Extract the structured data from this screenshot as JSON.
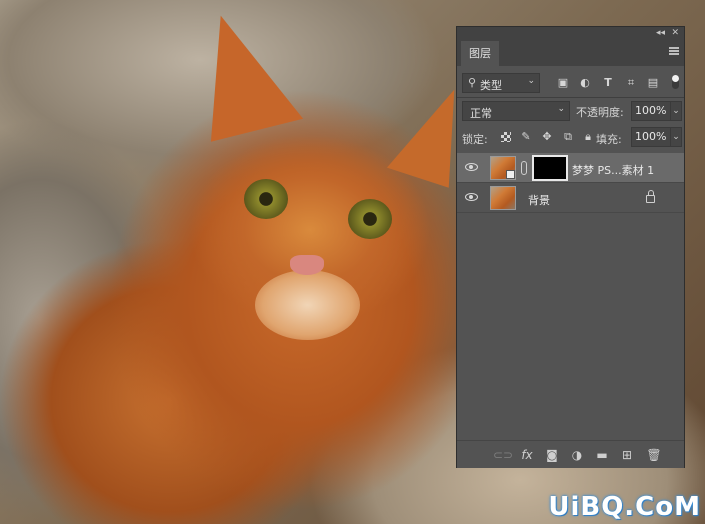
{
  "panel": {
    "tab_label": "图层",
    "collapse_glyph": "◂◂",
    "close_glyph": "✕",
    "filter": {
      "label": "类型",
      "icons": [
        "image-filter-icon",
        "adjustment-filter-icon",
        "type-filter-icon",
        "shape-filter-icon",
        "smart-object-filter-icon"
      ]
    },
    "blend_mode": "正常",
    "opacity_label": "不透明度:",
    "opacity_value": "100%",
    "lock_label": "锁定:",
    "fill_label": "填充:",
    "fill_value": "100%",
    "layers": [
      {
        "name": "梦梦 PS...素材 1",
        "visible": true,
        "selected": true,
        "has_mask": true
      },
      {
        "name": "背景",
        "visible": true,
        "selected": false,
        "locked": true
      }
    ],
    "footer_icons": [
      "link-layers-icon",
      "fx-icon",
      "add-mask-icon",
      "adjustment-layer-icon",
      "new-group-icon",
      "new-layer-icon",
      "delete-layer-icon"
    ],
    "fx_label": "fx"
  },
  "watermark": "UiBQ.CoM",
  "colors": {
    "panel_bg": "#535353",
    "selected_layer": "#6a6a6a",
    "watermark_glow": "#3b8fd8"
  }
}
